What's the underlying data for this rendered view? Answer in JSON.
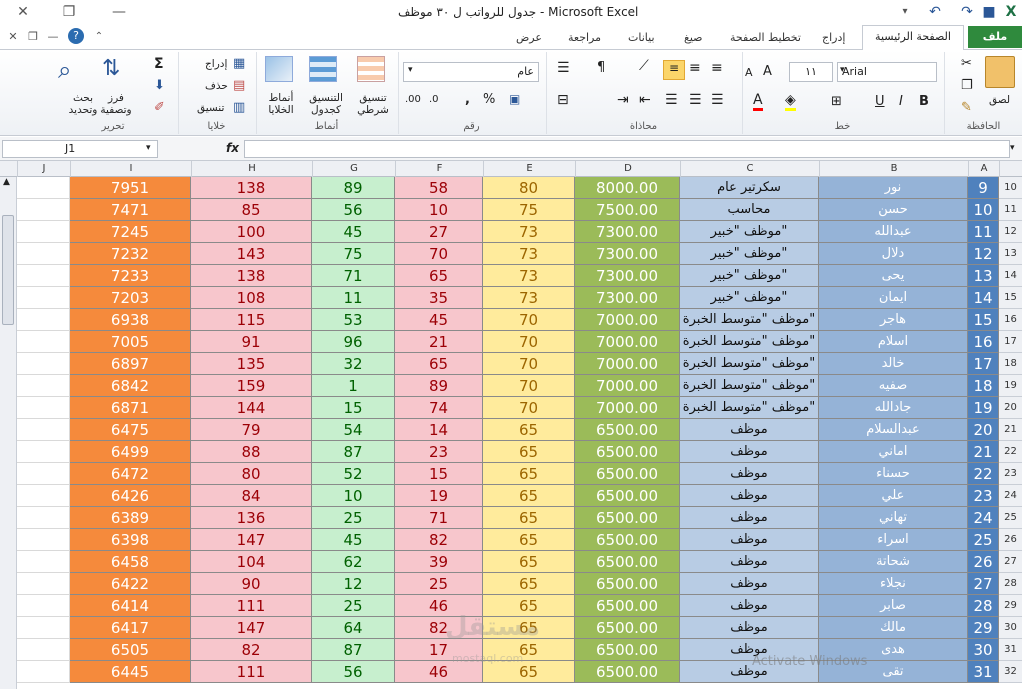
{
  "window": {
    "title": "جدول للرواتب ل ٣٠ موظف  -  Microsoft Excel"
  },
  "tabs": {
    "file": "ملف",
    "home": "الصفحة الرئيسية",
    "insert": "إدراج",
    "page_layout": "تخطيط الصفحة",
    "formulas": "صيغ",
    "data": "بيانات",
    "review": "مراجعة",
    "view": "عرض"
  },
  "ribbon": {
    "clipboard": {
      "label": "الحافظة",
      "paste": "لصق"
    },
    "font": {
      "label": "خط",
      "name": "Arial",
      "size": "١١"
    },
    "alignment": {
      "label": "محاذاة"
    },
    "number": {
      "label": "رقم",
      "format": "عام",
      "percent": "%",
      "comma": ","
    },
    "styles": {
      "label": "أنماط",
      "conditional": "تنسيق شرطي",
      "as_table": "التنسيق كجدول",
      "cell_styles": "أنماط الخلايا"
    },
    "cells": {
      "label": "خلايا",
      "insert": "إدراج",
      "delete": "حذف",
      "format": "تنسيق"
    },
    "editing": {
      "label": "تحرير",
      "sort": "فرز وتصفية",
      "find": "بحث وتحديد",
      "sum": "Σ"
    }
  },
  "formula_bar": {
    "name_box": "J1",
    "fx": "fx",
    "formula": ""
  },
  "columns": [
    "J",
    "I",
    "H",
    "G",
    "F",
    "E",
    "D",
    "C",
    "B",
    "A"
  ],
  "rows": [
    {
      "rn": "10",
      "A": "9",
      "B": "نور",
      "C": "سكرتير عام",
      "D": "8000.00",
      "E": "80",
      "F": "58",
      "G": "89",
      "H": "138",
      "I": "7951"
    },
    {
      "rn": "11",
      "A": "10",
      "B": "حسن",
      "C": "محاسب",
      "D": "7500.00",
      "E": "75",
      "F": "10",
      "G": "56",
      "H": "85",
      "I": "7471"
    },
    {
      "rn": "12",
      "A": "11",
      "B": "عبدالله",
      "C": "موظف \"خبير\"",
      "D": "7300.00",
      "E": "73",
      "F": "27",
      "G": "45",
      "H": "100",
      "I": "7245"
    },
    {
      "rn": "13",
      "A": "12",
      "B": "دلال",
      "C": "موظف \"خبير\"",
      "D": "7300.00",
      "E": "73",
      "F": "70",
      "G": "75",
      "H": "143",
      "I": "7232"
    },
    {
      "rn": "14",
      "A": "13",
      "B": "يحى",
      "C": "موظف \"خبير\"",
      "D": "7300.00",
      "E": "73",
      "F": "65",
      "G": "71",
      "H": "138",
      "I": "7233"
    },
    {
      "rn": "15",
      "A": "14",
      "B": "ايمان",
      "C": "موظف \"خبير\"",
      "D": "7300.00",
      "E": "73",
      "F": "35",
      "G": "11",
      "H": "108",
      "I": "7203"
    },
    {
      "rn": "16",
      "A": "15",
      "B": "هاجر",
      "C": "موظف \"متوسط الخبرة\"",
      "D": "7000.00",
      "E": "70",
      "F": "45",
      "G": "53",
      "H": "115",
      "I": "6938"
    },
    {
      "rn": "17",
      "A": "16",
      "B": "اسلام",
      "C": "موظف \"متوسط الخبرة\"",
      "D": "7000.00",
      "E": "70",
      "F": "21",
      "G": "96",
      "H": "91",
      "I": "7005"
    },
    {
      "rn": "18",
      "A": "17",
      "B": "خالد",
      "C": "موظف \"متوسط الخبرة\"",
      "D": "7000.00",
      "E": "70",
      "F": "65",
      "G": "32",
      "H": "135",
      "I": "6897"
    },
    {
      "rn": "19",
      "A": "18",
      "B": "صفيه",
      "C": "موظف \"متوسط الخبرة\"",
      "D": "7000.00",
      "E": "70",
      "F": "89",
      "G": "1",
      "H": "159",
      "I": "6842"
    },
    {
      "rn": "20",
      "A": "19",
      "B": "جادالله",
      "C": "موظف \"متوسط الخبرة\"",
      "D": "7000.00",
      "E": "70",
      "F": "74",
      "G": "15",
      "H": "144",
      "I": "6871"
    },
    {
      "rn": "21",
      "A": "20",
      "B": "عبدالسلام",
      "C": "موظف",
      "D": "6500.00",
      "E": "65",
      "F": "14",
      "G": "54",
      "H": "79",
      "I": "6475"
    },
    {
      "rn": "22",
      "A": "21",
      "B": "اماني",
      "C": "موظف",
      "D": "6500.00",
      "E": "65",
      "F": "23",
      "G": "87",
      "H": "88",
      "I": "6499"
    },
    {
      "rn": "23",
      "A": "22",
      "B": "حسناء",
      "C": "موظف",
      "D": "6500.00",
      "E": "65",
      "F": "15",
      "G": "52",
      "H": "80",
      "I": "6472"
    },
    {
      "rn": "24",
      "A": "23",
      "B": "علي",
      "C": "موظف",
      "D": "6500.00",
      "E": "65",
      "F": "19",
      "G": "10",
      "H": "84",
      "I": "6426"
    },
    {
      "rn": "25",
      "A": "24",
      "B": "تهاني",
      "C": "موظف",
      "D": "6500.00",
      "E": "65",
      "F": "71",
      "G": "25",
      "H": "136",
      "I": "6389"
    },
    {
      "rn": "26",
      "A": "25",
      "B": "اسراء",
      "C": "موظف",
      "D": "6500.00",
      "E": "65",
      "F": "82",
      "G": "45",
      "H": "147",
      "I": "6398"
    },
    {
      "rn": "27",
      "A": "26",
      "B": "شحاتة",
      "C": "موظف",
      "D": "6500.00",
      "E": "65",
      "F": "39",
      "G": "62",
      "H": "104",
      "I": "6458"
    },
    {
      "rn": "28",
      "A": "27",
      "B": "نجلاء",
      "C": "موظف",
      "D": "6500.00",
      "E": "65",
      "F": "25",
      "G": "12",
      "H": "90",
      "I": "6422"
    },
    {
      "rn": "29",
      "A": "28",
      "B": "صابر",
      "C": "موظف",
      "D": "6500.00",
      "E": "65",
      "F": "46",
      "G": "25",
      "H": "111",
      "I": "6414"
    },
    {
      "rn": "30",
      "A": "29",
      "B": "مالك",
      "C": "موظف",
      "D": "6500.00",
      "E": "65",
      "F": "82",
      "G": "64",
      "H": "147",
      "I": "6417"
    },
    {
      "rn": "31",
      "A": "30",
      "B": "هدى",
      "C": "موظف",
      "D": "6500.00",
      "E": "65",
      "F": "17",
      "G": "87",
      "H": "82",
      "I": "6505"
    },
    {
      "rn": "32",
      "A": "31",
      "B": "تقى",
      "C": "موظف",
      "D": "6500.00",
      "E": "65",
      "F": "46",
      "G": "56",
      "H": "111",
      "I": "6445"
    }
  ],
  "overlay": {
    "watermark": "مستقل",
    "watermark_sub": "mostaql.com",
    "activate": "Activate Windows"
  },
  "colors": {
    "file_tab": "#2f8a3d",
    "col_I": "#f58a3c",
    "col_H": "#f7c6cc",
    "col_G": "#c7efce",
    "col_F": "#f7c6cc",
    "col_E": "#ffeb9c",
    "col_D": "#9bbb59",
    "col_C": "#b8cce4",
    "col_B": "#95b3d7",
    "col_A": "#4f81bd"
  }
}
